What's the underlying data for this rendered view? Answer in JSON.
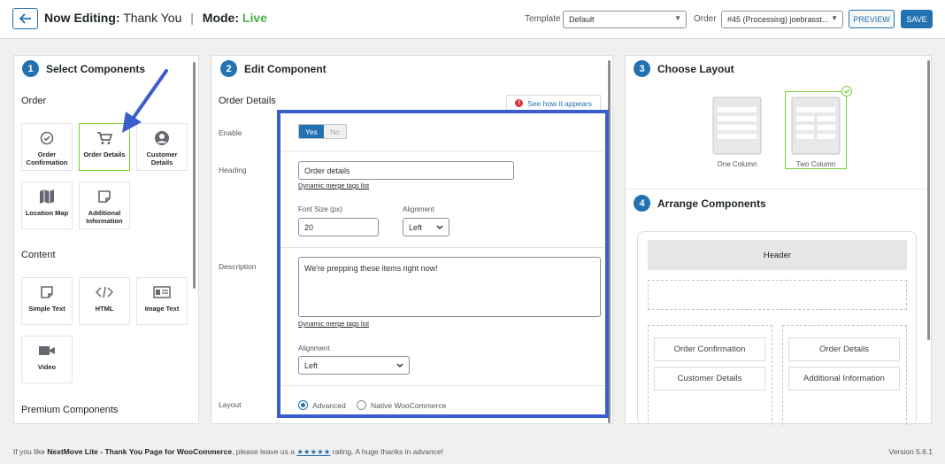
{
  "header": {
    "editing_label": "Now Editing:",
    "page_name": "Thank You",
    "separator": "|",
    "mode_label": "Mode:",
    "mode_value": "Live",
    "template_label": "Template",
    "template_value": "Default",
    "order_label": "Order",
    "order_value": "#45 (Processing) joebrasst...",
    "preview_label": "PREVIEW",
    "save_label": "SAVE"
  },
  "select_panel": {
    "step": "1",
    "title": "Select Components",
    "order_section": "Order",
    "order_items": [
      {
        "label": "Order Confirmation",
        "icon": "check-circle-icon"
      },
      {
        "label": "Order Details",
        "icon": "cart-icon"
      },
      {
        "label": "Customer Details",
        "icon": "user-icon"
      },
      {
        "label": "Location Map",
        "icon": "map-icon"
      },
      {
        "label": "Additional Information",
        "icon": "note-icon"
      }
    ],
    "content_section": "Content",
    "content_items": [
      {
        "label": "Simple Text",
        "icon": "note-icon"
      },
      {
        "label": "HTML",
        "icon": "code-icon"
      },
      {
        "label": "Image Text",
        "icon": "id-card-icon"
      },
      {
        "label": "Video",
        "icon": "video-icon"
      }
    ],
    "premium_section": "Premium Components"
  },
  "edit_panel": {
    "step": "2",
    "title": "Edit Component",
    "component_title": "Order Details",
    "see_how": "See how it appears",
    "enable_label": "Enable",
    "enable_yes": "Yes",
    "enable_no": "No",
    "heading_label": "Heading",
    "heading_value": "Order details",
    "merge_tags_link": "Dynamic merge tags list",
    "font_size_label": "Font Size (px)",
    "font_size_value": "20",
    "alignment_label": "Alignment",
    "alignment_value": "Left",
    "description_label": "Description",
    "description_value": "We're prepping these items right now!",
    "desc_merge_tags_link": "Dynamic merge tags list",
    "desc_alignment_label": "Alignment",
    "desc_alignment_value": "Left",
    "layout_label": "Layout",
    "layout_options": [
      "Advanced",
      "Native WooCommerce"
    ],
    "layout_selected": "Advanced"
  },
  "layout_panel": {
    "step": "3",
    "title": "Choose Layout",
    "options": [
      "One Column",
      "Two Column"
    ],
    "selected": "Two Column"
  },
  "arrange_panel": {
    "step": "4",
    "title": "Arrange Components",
    "header": "Header",
    "left_column": [
      "Order Confirmation",
      "Customer Details"
    ],
    "right_column": [
      "Order Details",
      "Additional Information"
    ]
  },
  "footer": {
    "prefix": "If you like",
    "plugin_name": "NextMove Lite - Thank You Page for WooCommerce",
    "middle": ", please leave us a",
    "stars": "★★★★★",
    "suffix": "rating. A huge thanks in advance!",
    "version": "Version 5.6.1"
  },
  "colors": {
    "accent": "#2271b1",
    "live": "#4caf50",
    "selected_border": "#7ad03a",
    "highlight_box": "#3a5dcc"
  }
}
